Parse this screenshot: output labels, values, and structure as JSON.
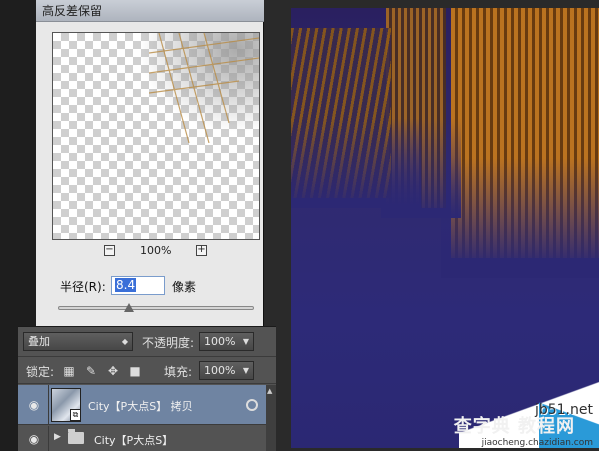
{
  "dialog": {
    "title": "高反差保留",
    "zoom_minus": "−",
    "zoom_value": "100%",
    "zoom_plus": "+",
    "radius_label": "半径(R):",
    "radius_value": "8.4",
    "unit_label": "像素"
  },
  "layers_panel": {
    "blend_mode": "叠加",
    "opacity_label": "不透明度:",
    "opacity_value": "100%",
    "lock_label": "锁定:",
    "fill_label": "填充:",
    "fill_value": "100%",
    "layers": [
      {
        "name": "City【P大点S】 拷贝",
        "selected": true,
        "visible": true
      },
      {
        "name": "City【P大点S】",
        "selected": false,
        "visible": true,
        "type": "group"
      }
    ]
  },
  "watermark": {
    "site": "jb51.net",
    "brand": "查字典 教程网",
    "url": "jiaocheng.chazidian.com"
  },
  "colors": {
    "canvas_bg": "#2c2874",
    "building_gold": "#c2771c",
    "selection_blue": "#6f84a2",
    "panel_gray": "#535353"
  }
}
